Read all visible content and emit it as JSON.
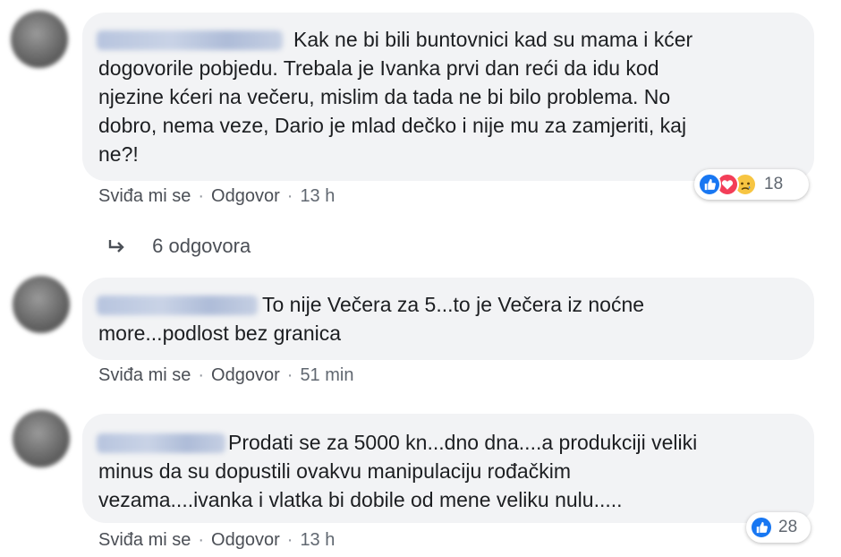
{
  "comments": [
    {
      "text": "Kak ne bi bili buntovnici kad su mama i kćer\ndogovorile pobjedu. Trebala je Ivanka prvi dan reći da idu kod\nnjezine kćeri na večeru, mislim da tada ne bi bilo problema. No\ndobro, nema veze, Dario je mlad dečko i nije mu za zamjeriti, kaj\nne?!",
      "like_label": "Sviđa mi se",
      "reply_label": "Odgovor",
      "time": "13 h",
      "reaction_count": "18",
      "reactions": [
        "like-icon",
        "love-icon",
        "sad-icon"
      ]
    },
    {
      "text": "To nije Večera za 5...to je Večera iz noćne\nmore...podlost bez granica",
      "like_label": "Sviđa mi se",
      "reply_label": "Odgovor",
      "time": "51 min"
    },
    {
      "text": "Prodati se za 5000 kn...dno dna....a produkciji veliki\nminus da su dopustili ovakvu manipulaciju rođačkim\nvezama....ivanka i vlatka bi dobile od mene veliku nulu.....",
      "like_label": "Sviđa mi se",
      "reply_label": "Odgovor",
      "time": "13 h",
      "reaction_count": "28",
      "reactions": [
        "like-icon"
      ]
    }
  ],
  "replies_link": {
    "label": "6 odgovora",
    "icon": "reply-arrow-icon"
  },
  "separator": "·",
  "colors": {
    "bubble": "#f2f3f5",
    "like": "#1877f2",
    "love": "#f33e58",
    "sad": "#f7c542",
    "meta_text": "#606770"
  }
}
